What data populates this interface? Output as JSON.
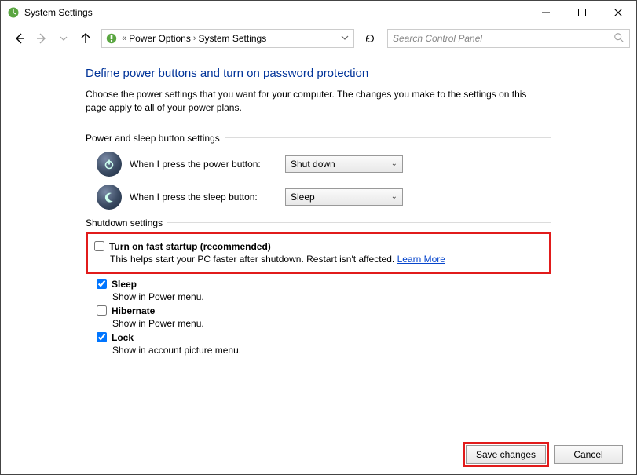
{
  "window": {
    "title": "System Settings"
  },
  "breadcrumb": {
    "item1": "Power Options",
    "item2": "System Settings"
  },
  "search": {
    "placeholder": "Search Control Panel"
  },
  "heading": "Define power buttons and turn on password protection",
  "description": "Choose the power settings that you want for your computer. The changes you make to the settings on this page apply to all of your power plans.",
  "section1": {
    "title": "Power and sleep button settings",
    "row1_label": "When I press the power button:",
    "row1_value": "Shut down",
    "row2_label": "When I press the sleep button:",
    "row2_value": "Sleep"
  },
  "section2": {
    "title": "Shutdown settings",
    "fast_startup": {
      "label": "Turn on fast startup (recommended)",
      "sub": "This helps start your PC faster after shutdown. Restart isn't affected. ",
      "link": "Learn More",
      "checked": false
    },
    "sleep": {
      "label": "Sleep",
      "sub": "Show in Power menu.",
      "checked": true
    },
    "hibernate": {
      "label": "Hibernate",
      "sub": "Show in Power menu.",
      "checked": false
    },
    "lock": {
      "label": "Lock",
      "sub": "Show in account picture menu.",
      "checked": true
    }
  },
  "footer": {
    "save": "Save changes",
    "cancel": "Cancel"
  }
}
